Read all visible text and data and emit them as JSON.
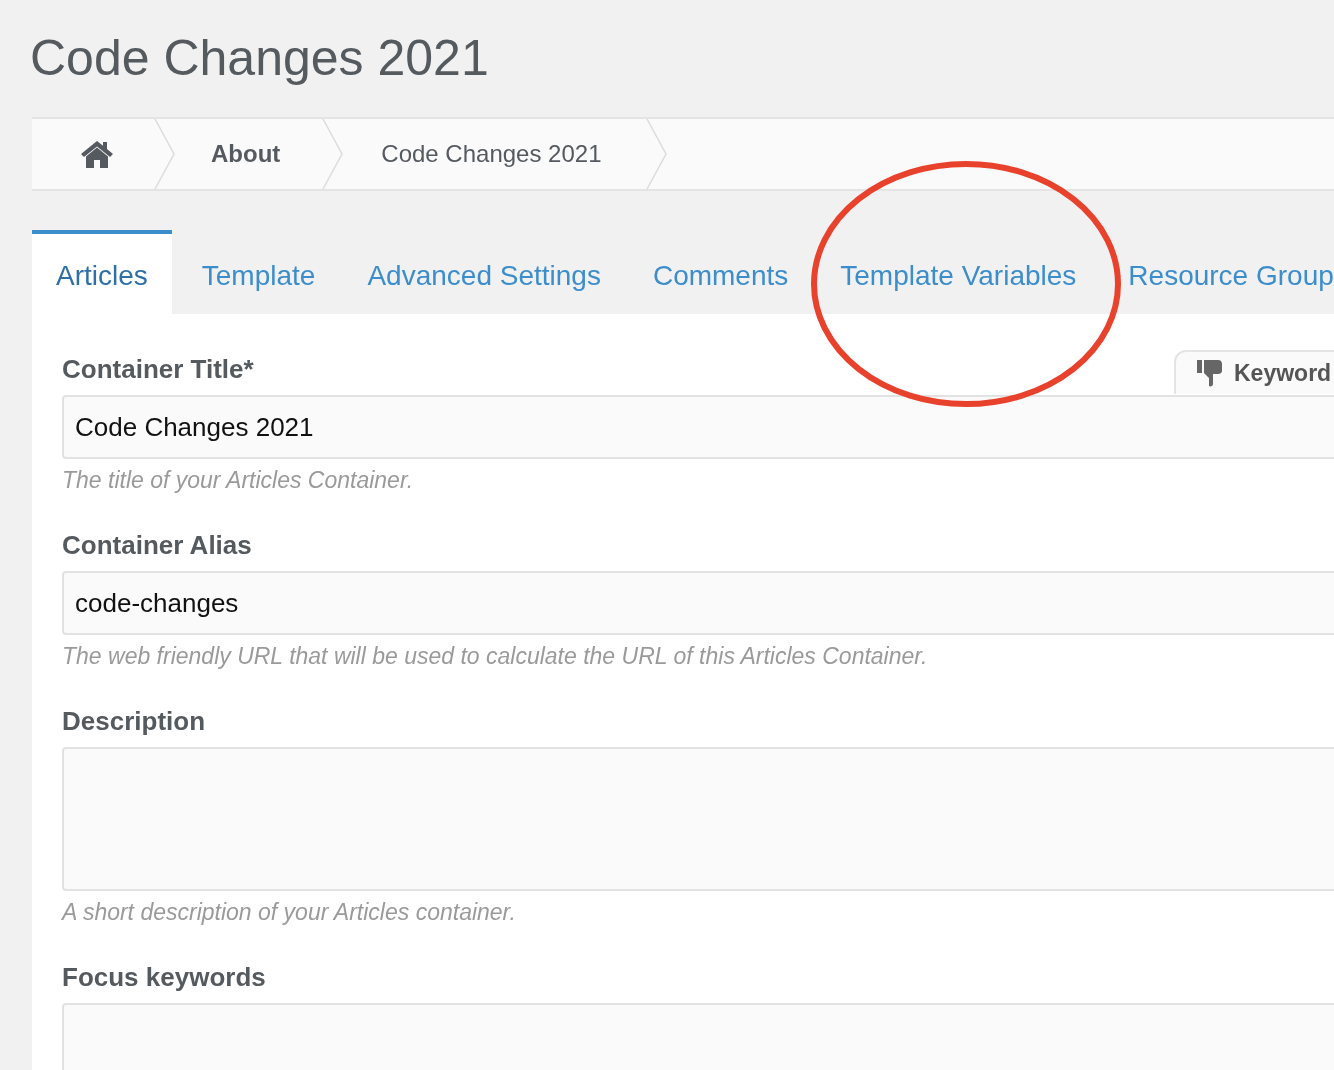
{
  "page_title": "Code Changes 2021",
  "breadcrumb": [
    {
      "kind": "home"
    },
    {
      "kind": "link",
      "label": "About"
    },
    {
      "kind": "current",
      "label": "Code Changes 2021"
    }
  ],
  "tabs": [
    {
      "label": "Articles",
      "selected": true
    },
    {
      "label": "Template",
      "selected": false
    },
    {
      "label": "Advanced Settings",
      "selected": false
    },
    {
      "label": "Comments",
      "selected": false
    },
    {
      "label": "Template Variables",
      "selected": false
    },
    {
      "label": "Resource Group",
      "selected": false
    }
  ],
  "keyword_tab": {
    "label": "Keyword"
  },
  "fields": [
    {
      "label": "Container Title*",
      "kind": "input",
      "value": "Code Changes 2021",
      "help": "The title of your Articles Container."
    },
    {
      "label": "Container Alias",
      "kind": "input",
      "value": "code-changes",
      "help": "The web friendly URL that will be used to calculate the URL of this Articles Container."
    },
    {
      "label": "Description",
      "kind": "textarea",
      "help": "A short description of your Articles container."
    },
    {
      "label": "Focus keywords",
      "kind": "textarea"
    }
  ]
}
